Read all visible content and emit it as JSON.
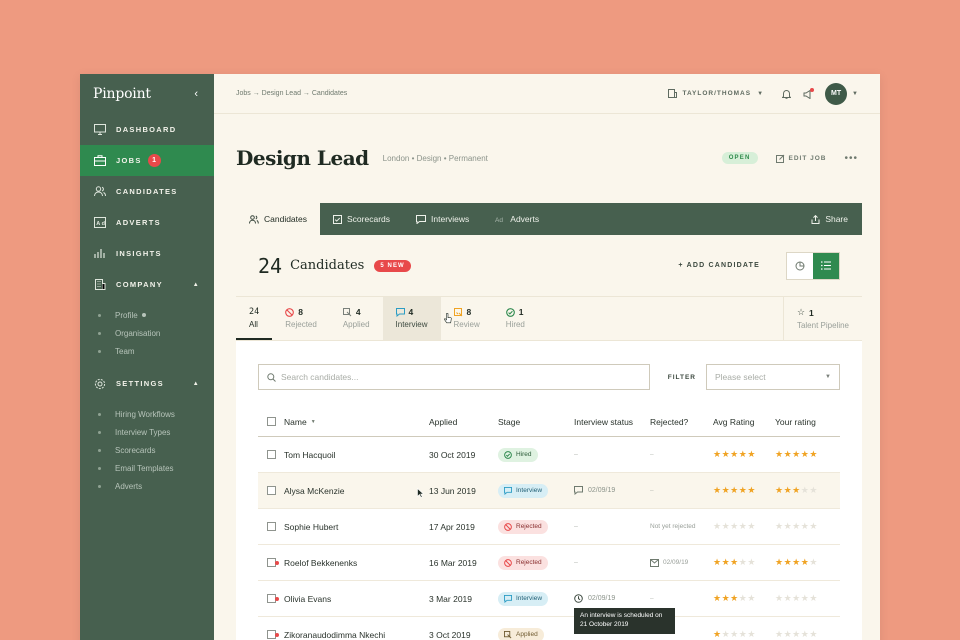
{
  "sidebar": {
    "brand": "Pinpoint",
    "items": [
      {
        "label": "DASHBOARD"
      },
      {
        "label": "JOBS",
        "badge": "1"
      },
      {
        "label": "CANDIDATES"
      },
      {
        "label": "ADVERTS"
      },
      {
        "label": "INSIGHTS"
      },
      {
        "label": "COMPANY"
      }
    ],
    "company_sub": [
      "Profile",
      "Organisation",
      "Team"
    ],
    "settings_label": "SETTINGS",
    "settings_sub": [
      "Hiring Workflows",
      "Interview Types",
      "Scorecards",
      "Email Templates",
      "Adverts"
    ]
  },
  "topbar": {
    "breadcrumb": "Jobs → Design Lead → Candidates",
    "account": "TAYLOR/THOMAS",
    "avatar": "MT"
  },
  "job": {
    "title": "Design Lead",
    "meta": "London • Design • Permanent",
    "status": "OPEN",
    "edit": "EDIT JOB",
    "more": "•••"
  },
  "tabs": [
    {
      "label": "Candidates",
      "icon": "people-icon"
    },
    {
      "label": "Scorecards",
      "icon": "checkbox-icon"
    },
    {
      "label": "Interviews",
      "icon": "chat-icon"
    },
    {
      "label": "Adverts",
      "icon": "ad-icon"
    }
  ],
  "share": "Share",
  "summary": {
    "count": "24",
    "label": "Candidates",
    "new_badge": "5 NEW",
    "add": "+ ADD CANDIDATE"
  },
  "stages": [
    {
      "count": "24",
      "label": "All"
    },
    {
      "count": "8",
      "label": "Rejected"
    },
    {
      "count": "4",
      "label": "Applied"
    },
    {
      "count": "4",
      "label": "Interview"
    },
    {
      "count": "8",
      "label": "Review"
    },
    {
      "count": "1",
      "label": "Hired"
    },
    {
      "count": "1",
      "label": "Talent Pipeline"
    }
  ],
  "search": {
    "placeholder": "Search candidates..."
  },
  "filter": {
    "label": "FILTER",
    "placeholder": "Please select"
  },
  "columns": [
    "Name",
    "Applied",
    "Stage",
    "Interview status",
    "Rejected?",
    "Avg Rating",
    "Your rating"
  ],
  "rows": [
    {
      "name": "Tom Hacquoil",
      "applied": "30 Oct 2019",
      "stage": "Hired",
      "interview": "–",
      "rejected": "–",
      "avg": 4.5,
      "yours": 5
    },
    {
      "name": "Alysa McKenzie",
      "applied": "13 Jun 2019",
      "stage": "Interview",
      "interview": "02/09/19",
      "rejected": "–",
      "avg": 4.5,
      "yours": 3
    },
    {
      "name": "Sophie Hubert",
      "applied": "17 Apr 2019",
      "stage": "Rejected",
      "interview": "–",
      "rejected": "Not yet rejected",
      "avg": 0,
      "yours": 0
    },
    {
      "name": "Roelof Bekkenenks",
      "applied": "16 Mar 2019",
      "stage": "Rejected",
      "interview": "–",
      "rejected": "02/09/19",
      "avg": 3,
      "yours": 4
    },
    {
      "name": "Olivia Evans",
      "applied": "3 Mar 2019",
      "stage": "Interview",
      "interview": "02/09/19",
      "rejected": "–",
      "avg": 3,
      "yours": 0
    },
    {
      "name": "Zikoranaudodimma Nkechi",
      "applied": "3 Oct 2019",
      "stage": "Applied",
      "interview": "",
      "rejected": "",
      "avg": 1,
      "yours": 0
    }
  ],
  "tooltip": "An interview is scheduled on 21 October 2019"
}
